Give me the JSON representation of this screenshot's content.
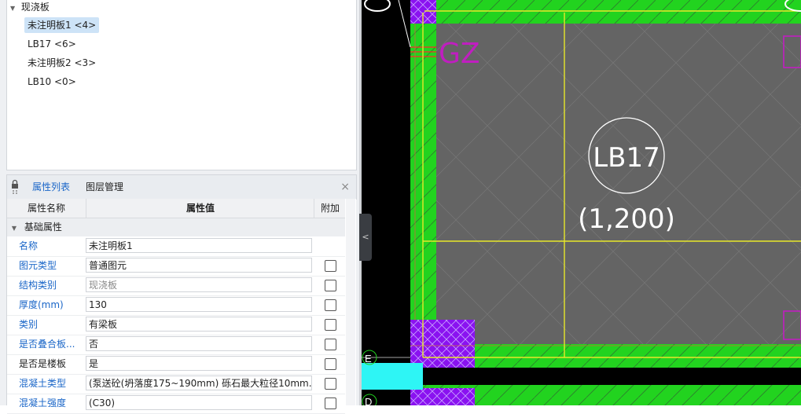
{
  "tree": {
    "root_label": "现浇板",
    "items": [
      {
        "label": "未注明板1 <4>"
      },
      {
        "label": "LB17 <6>"
      },
      {
        "label": "未注明板2 <3>"
      },
      {
        "label": "LB10 <0>"
      }
    ]
  },
  "panel": {
    "tabs": [
      {
        "label": "属性列表"
      },
      {
        "label": "图层管理"
      }
    ],
    "close": "×",
    "headers": {
      "name": "属性名称",
      "value": "属性值",
      "extra": "附加"
    },
    "group": "基础属性",
    "rows": [
      {
        "name": "名称",
        "value": "未注明板1"
      },
      {
        "name": "图元类型",
        "value": "普通图元"
      },
      {
        "name": "结构类别",
        "value": "现浇板"
      },
      {
        "name": "厚度(mm)",
        "value": "130"
      },
      {
        "name": "类别",
        "value": "有梁板"
      },
      {
        "name": "是否叠合板...",
        "value": "否"
      },
      {
        "name": "是否是楼板",
        "value": "是"
      },
      {
        "name": "混凝土类型",
        "value": "(泵送砼(坍落度175~190mm) 砾石最大粒径10mm..."
      },
      {
        "name": "混凝土强度",
        "value": "(C30)"
      }
    ]
  },
  "cad": {
    "slab_label": "LB17",
    "slab_thickness": "(1,200)",
    "column_label": "GZ",
    "axis_labels": [
      "E",
      "D"
    ]
  }
}
